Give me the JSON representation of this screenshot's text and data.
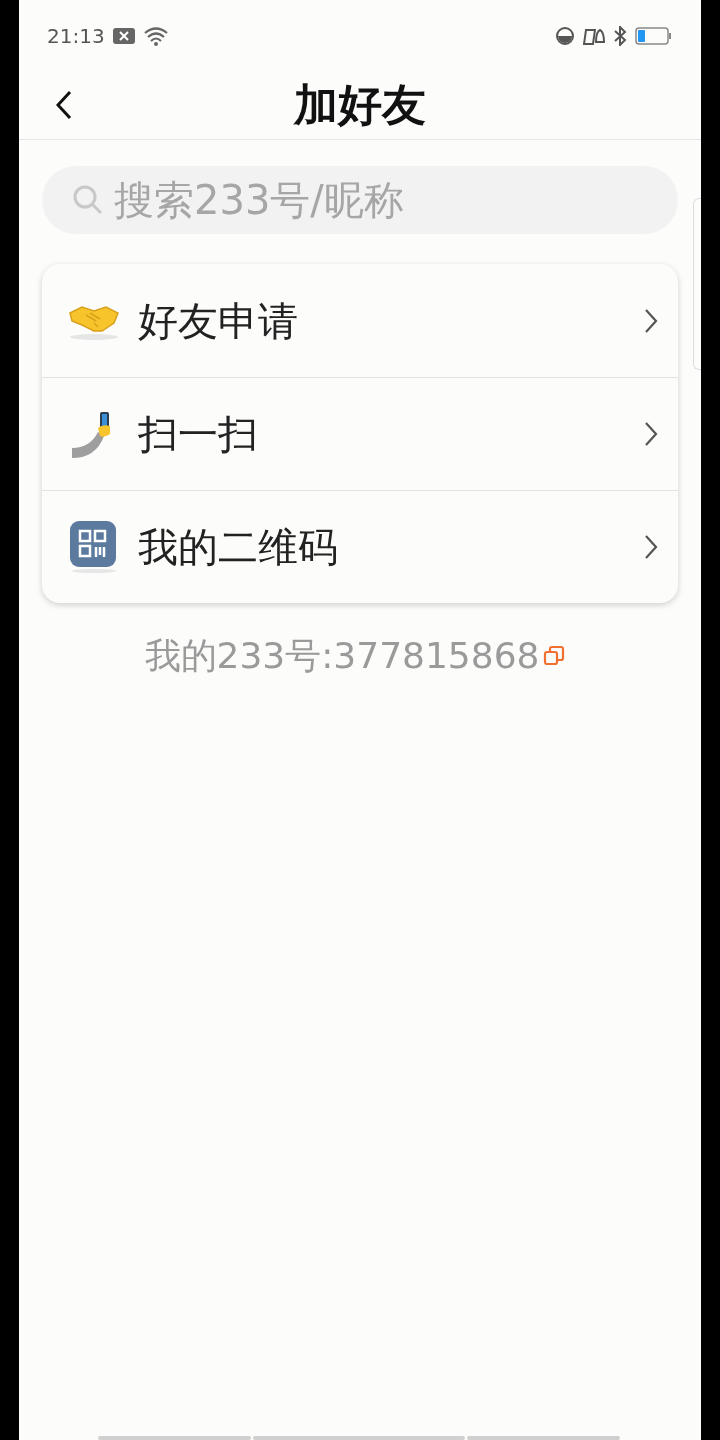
{
  "status_bar": {
    "time": "21:13"
  },
  "header": {
    "title": "加好友"
  },
  "search": {
    "placeholder": "搜索233号/昵称"
  },
  "menu": [
    {
      "label": "好友申请"
    },
    {
      "label": "扫一扫"
    },
    {
      "label": "我的二维码"
    }
  ],
  "my_id": "我的233号:377815868"
}
